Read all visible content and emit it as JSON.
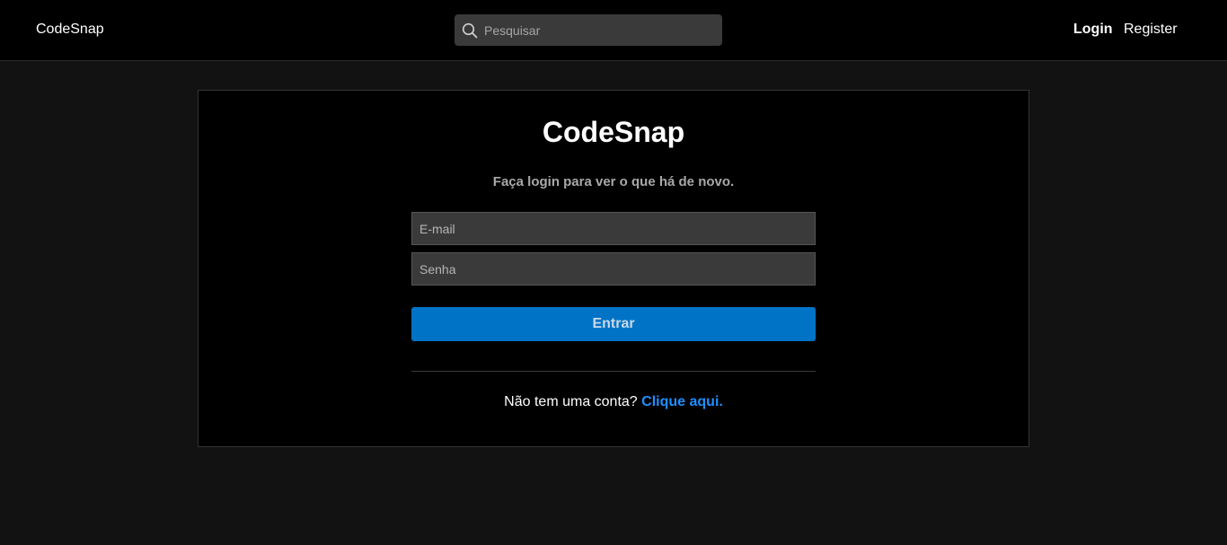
{
  "header": {
    "brand": "CodeSnap",
    "search": {
      "placeholder": "Pesquisar",
      "icon": "search-icon"
    },
    "nav": {
      "login": "Login",
      "register": "Register"
    }
  },
  "login_card": {
    "title": "CodeSnap",
    "subtitle": "Faça login para ver o que há de novo.",
    "email_placeholder": "E-mail",
    "password_placeholder": "Senha",
    "submit_label": "Entrar",
    "signup_text": "Não tem uma conta?",
    "signup_link": "Clique aqui."
  },
  "colors": {
    "page_background": "#121212",
    "header_background": "#000000",
    "card_background": "#000000",
    "input_background": "#3a3a3a",
    "primary_button": "#0073c7",
    "link": "#1e90ff"
  }
}
